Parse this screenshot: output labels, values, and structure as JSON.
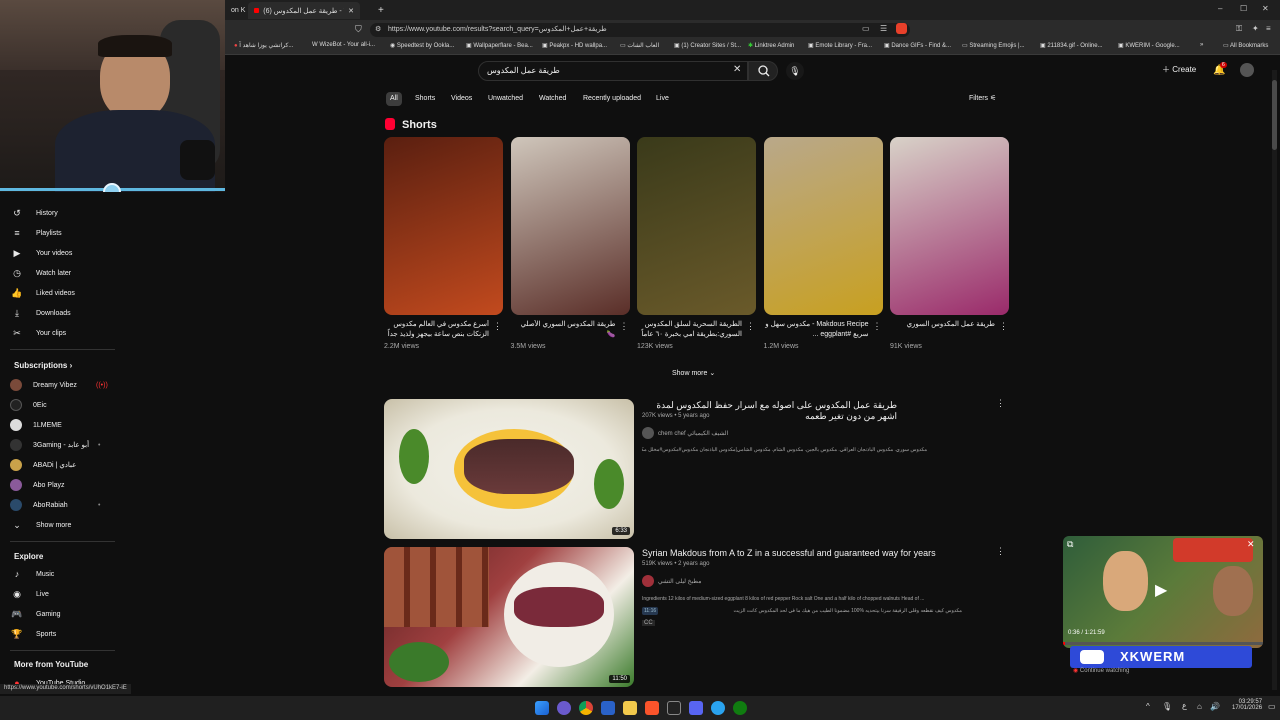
{
  "browser": {
    "tabs": [
      {
        "label": "on K"
      },
      {
        "label": "(6) طريقة عمل المكدوس - YouTube"
      }
    ],
    "url": "https://www.youtube.com/results?search_query=طريقة+عمل+المكدوس",
    "status_url": "https://www.youtube.com/shorts/vUhO1kE7-iE",
    "bookmarks": [
      {
        "label": "كراتشي يوزا شاهد آ..."
      },
      {
        "label": "WizeBot - Your all-i..."
      },
      {
        "label": "Speedtest by Ookla..."
      },
      {
        "label": "Wallpaperflare - Bea..."
      },
      {
        "label": "Peakpx - HD wallpa..."
      },
      {
        "label": "العاب الشات"
      },
      {
        "label": "(1) Creator Sites / St..."
      },
      {
        "label": "Linktree Admin"
      },
      {
        "label": "Emote Library - Fra..."
      },
      {
        "label": "Dance GIFs - Find &..."
      },
      {
        "label": "Streaming Emojis |..."
      },
      {
        "label": "211834.gif - Online..."
      },
      {
        "label": "KWERIM - Google..."
      },
      {
        "label": "All Bookmarks"
      }
    ]
  },
  "header": {
    "search_value": "طريقة عمل المكدوس",
    "create_label": "Create",
    "notification_count": "6"
  },
  "filters": {
    "chips": [
      "All",
      "Shorts",
      "Videos",
      "Unwatched",
      "Watched",
      "Recently uploaded",
      "Live"
    ],
    "filters_label": "Filters"
  },
  "sidebar": {
    "you_items": [
      {
        "label": "History",
        "icon": "history-icon"
      },
      {
        "label": "Playlists",
        "icon": "playlists-icon"
      },
      {
        "label": "Your videos",
        "icon": "your-videos-icon"
      },
      {
        "label": "Watch later",
        "icon": "watch-later-icon"
      },
      {
        "label": "Liked videos",
        "icon": "liked-icon"
      },
      {
        "label": "Downloads",
        "icon": "download-icon"
      },
      {
        "label": "Your clips",
        "icon": "clips-icon"
      }
    ],
    "subscriptions_title": "Subscriptions",
    "subscriptions": [
      {
        "label": "Dreamy Vibez",
        "color": "#7a4a3a",
        "live": true
      },
      {
        "label": "0Eic",
        "color": "#222222",
        "live": false
      },
      {
        "label": "1LMEME",
        "color": "#dddddd",
        "live": false
      },
      {
        "label": "3Gaming - أبو عابد",
        "color": "#333333",
        "live": false
      },
      {
        "label": "ABADi | عبادي",
        "color": "#c9a24a",
        "live": false
      },
      {
        "label": "Abo Playz",
        "color": "#8a5a9a",
        "live": false
      },
      {
        "label": "AboRabiah",
        "color": "#2a4a6a",
        "live": false
      }
    ],
    "show_more": "Show more",
    "explore_title": "Explore",
    "explore": [
      {
        "label": "Music",
        "icon": "music-icon"
      },
      {
        "label": "Live",
        "icon": "live-icon"
      },
      {
        "label": "Gaming",
        "icon": "gaming-icon"
      },
      {
        "label": "Sports",
        "icon": "sports-icon"
      }
    ],
    "more_title": "More from YouTube",
    "more_items": [
      {
        "label": "YouTube Studio"
      }
    ]
  },
  "shorts": {
    "section_title": "Shorts",
    "items": [
      {
        "title": "أسرع مكدوس في العالم مكدوس الزنكات بنص ساعة بيجهز ولذيذ جداً فووووو",
        "views": "2.2M views",
        "colors": [
          "#5a1f10",
          "#c24a1e"
        ]
      },
      {
        "title": "طريقة المكدوس السوري الأصلي 🍆",
        "views": "3.5M views",
        "colors": [
          "#cfc6bb",
          "#5a2e28"
        ]
      },
      {
        "title": "الطريقة السحرية لسلق المكدوس السوري:بطريقة امي بخبرة ٦٠ عاماً",
        "views": "123K views",
        "colors": [
          "#3a3a1a",
          "#6a5a2a"
        ]
      },
      {
        "title": "Makdous Recipe - مكدوس سهل و سريع #eggplant ...",
        "views": "1.2M views",
        "colors": [
          "#b9a88a",
          "#c8a020"
        ]
      },
      {
        "title": "طريقة عمل المكدوس السوري",
        "views": "91K views",
        "colors": [
          "#d8d2c8",
          "#9a2a6a"
        ]
      }
    ],
    "show_more": "Show more"
  },
  "videos": [
    {
      "title": "طريقة عمل المكدوس على اصوله مع اسرار حفظ المكدوس لمدة اشهر من دون تغير طعمه",
      "meta": "207K views • 5 years ago",
      "channel": "chem chef الشيف الكيميائي",
      "description": "مكدوس سوري. مكدوس الباذنجان العراقي. مكدوس بالجبن. مكدوس الشام. مكدوس الشامي|مكدوس الباذنجان مكدوس#مكدوس#مخلل مكدوس ...",
      "duration": "6:33"
    },
    {
      "title": "Syrian Makdous from A to Z in a successful and guaranteed way for years",
      "meta": "519K views • 2 years ago",
      "channel": "مطبخ ليلى التشي",
      "description": "Ingredients 12 kilos of medium-sized eggplant 8 kilos of red pepper Rock salt One and a half kilo of chopped walnuts Head of ...",
      "description2": "مكدوس كيف نقطعه وقلي الرفيقة سرنا بيتحديه %100 مضمونا الطيب من هيك ما في لحد المكدوس كانت الزيت",
      "chapter": "11:16",
      "cc": "CC",
      "duration": "11:50"
    }
  ],
  "miniplayer": {
    "time": "0:36 / 1:21:59",
    "banner": "XKWERM",
    "continue_label": "Continue watching"
  },
  "taskbar": {
    "time": "03:29:57",
    "date": "17/01/2026",
    "lang": "ع"
  }
}
